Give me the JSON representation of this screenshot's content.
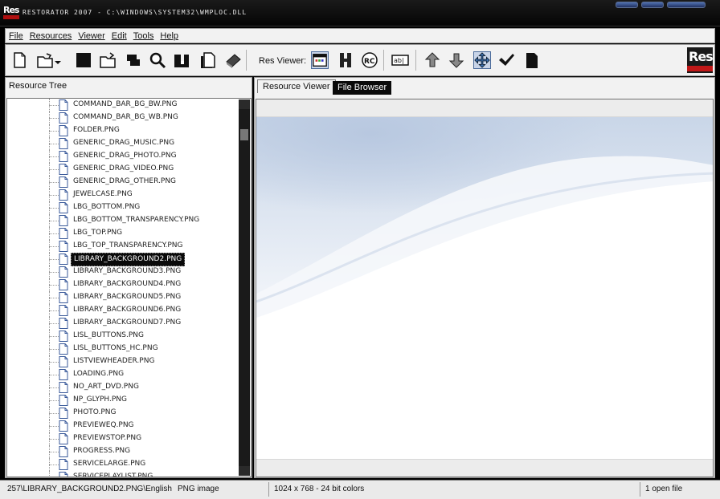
{
  "window": {
    "title": "Restorator 2007 - C:\\WINDOWS\\system32\\wmploc.dll",
    "logo_text": "Res"
  },
  "menu": [
    "File",
    "Resources",
    "Viewer",
    "Edit",
    "Tools",
    "Help"
  ],
  "toolbar": {
    "res_viewer_label": "Res Viewer:",
    "buttons": [
      "new-icon",
      "open-icon",
      "save-icon",
      "open-folder-icon",
      "copy-resource-icon",
      "find-icon",
      "extract-icon",
      "pages-icon",
      "book-icon",
      "view-normal-icon",
      "view-hex-icon",
      "view-rc-icon",
      "view-text-icon",
      "move-up-icon",
      "move-down-icon",
      "fit-icon",
      "check-icon",
      "document-icon"
    ],
    "brand_logo_text": "Res"
  },
  "resource_tree": {
    "label": "Resource Tree",
    "items": [
      "COMMAND_BAR_BG_BW.PNG",
      "COMMAND_BAR_BG_WB.PNG",
      "FOLDER.PNG",
      "GENERIC_DRAG_MUSIC.PNG",
      "GENERIC_DRAG_PHOTO.PNG",
      "GENERIC_DRAG_VIDEO.PNG",
      "GENERIC_DRAG_OTHER.PNG",
      "JEWELCASE.PNG",
      "LBG_BOTTOM.PNG",
      "LBG_BOTTOM_TRANSPARENCY.PNG",
      "LBG_TOP.PNG",
      "LBG_TOP_TRANSPARENCY.PNG",
      "LIBRARY_BACKGROUND2.PNG",
      "LIBRARY_BACKGROUND3.PNG",
      "LIBRARY_BACKGROUND4.PNG",
      "LIBRARY_BACKGROUND5.PNG",
      "LIBRARY_BACKGROUND6.PNG",
      "LIBRARY_BACKGROUND7.PNG",
      "LISL_BUTTONS.PNG",
      "LISL_BUTTONS_HC.PNG",
      "LISTVIEWHEADER.PNG",
      "LOADING.PNG",
      "NO_ART_DVD.PNG",
      "NP_GLYPH.PNG",
      "PHOTO.PNG",
      "PREVIEWEQ.PNG",
      "PREVIEWSTOP.PNG",
      "PROGRESS.PNG",
      "SERVICELARGE.PNG",
      "SERVICEPLAYLIST.PNG"
    ],
    "selected_index": 12
  },
  "tabs": {
    "viewer": "Resource Viewer",
    "file_browser": "File Browser"
  },
  "status": {
    "path": "257\\LIBRARY_BACKGROUND2.PNG\\English",
    "type": "PNG image",
    "dimensions": "1024 x 768 - 24 bit colors",
    "open_files": "1 open file"
  }
}
